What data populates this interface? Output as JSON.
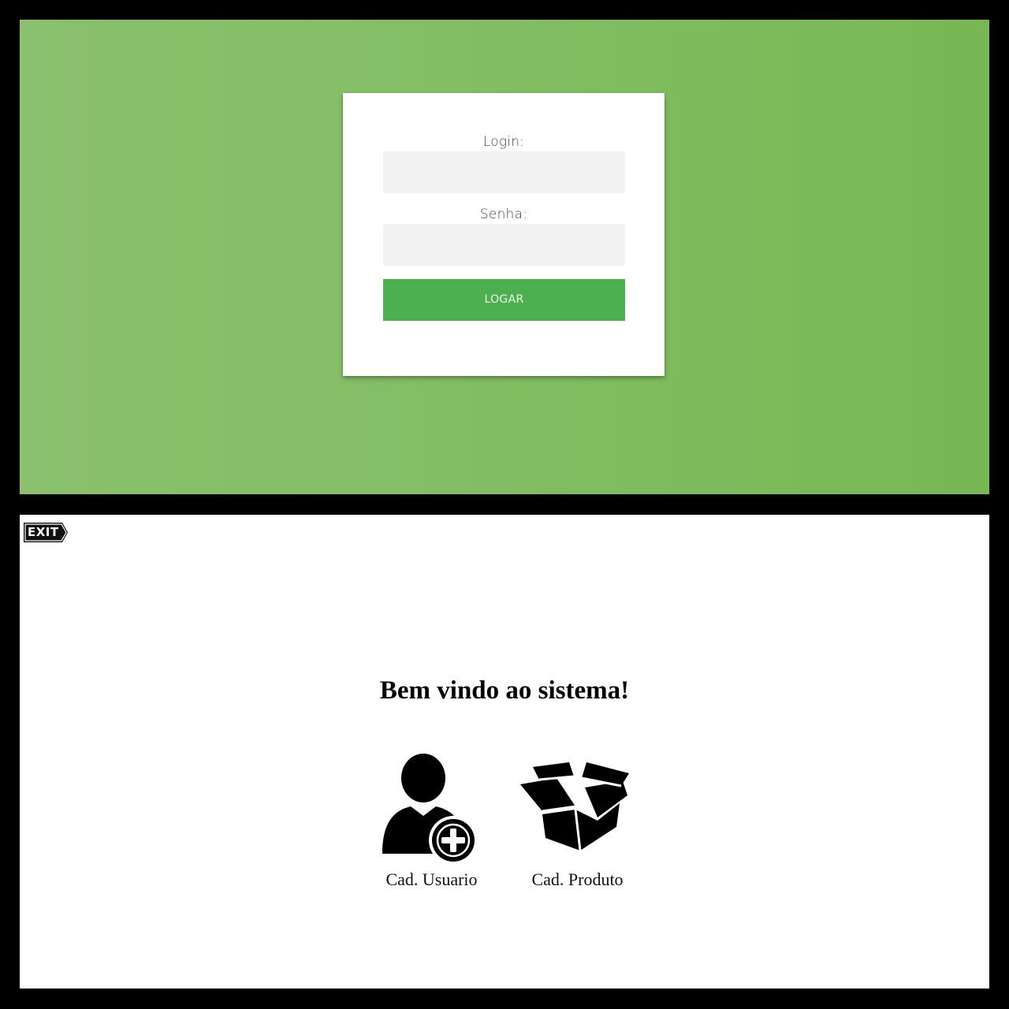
{
  "login_screen": {
    "login_label": "Login:",
    "password_label": "Senha:",
    "login_value": "",
    "password_value": "",
    "submit_label": "LOGAR",
    "background_colors": [
      "#8bc16e",
      "#77b853"
    ],
    "button_color": "#4caf50"
  },
  "home_screen": {
    "exit_label": "EXIT",
    "welcome_title": "Bem vindo ao sistema!",
    "menu": [
      {
        "label": "Cad. Usuario",
        "icon": "user-add-icon"
      },
      {
        "label": "Cad. Produto",
        "icon": "open-box-icon"
      }
    ]
  }
}
